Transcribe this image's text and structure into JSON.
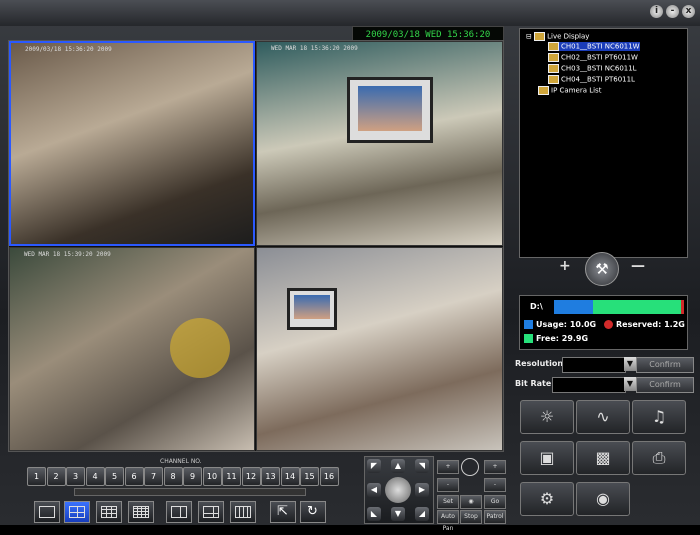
{
  "status": {
    "date": "2009/03/18",
    "weekday": "WED",
    "time": "15:36:20"
  },
  "window_controls": [
    "i",
    "-",
    "x"
  ],
  "cameras": [
    {
      "timestamp": "2009/03/18 15:36:20 2009"
    },
    {
      "timestamp": "WED MAR 18 15:36:20 2009"
    },
    {
      "timestamp": "WED MAR 18 15:39:20 2009"
    },
    {
      "timestamp": ""
    }
  ],
  "tree": {
    "root": "Live Display",
    "channels": [
      "CH01__BSTI NC6011W",
      "CH02__BSTI PT6011W",
      "CH03__BSTI NC6011L",
      "CH04__BSTI PT6011L"
    ],
    "ip_list": "IP Camera List"
  },
  "tool_row": {
    "plus": "+",
    "minus": "—",
    "tool_icon": "⚒"
  },
  "disk": {
    "drive": "D:\\",
    "usage_label": "Usage:",
    "usage_value": "10.0G",
    "reserved_label": "Reserved:",
    "reserved_value": "1.2G",
    "free_label": "Free:",
    "free_value": "29.9G",
    "free_fraction": 0.7,
    "colors": {
      "usage": "#1f7de0",
      "free": "#27e07a",
      "reserved": "#d12a2a"
    }
  },
  "settings": {
    "resolution_label": "Resolution",
    "bitrate_label": "Bit Rate",
    "confirm_label": "Confirm",
    "arrow": "▼"
  },
  "bottom": {
    "channel_label": "CHANNEL NO.",
    "channels": [
      "1",
      "2",
      "3",
      "4",
      "5",
      "6",
      "7",
      "8",
      "9",
      "10",
      "11",
      "12",
      "13",
      "14",
      "15",
      "16"
    ]
  },
  "ptz": {
    "arrows": [
      "◤",
      "▲",
      "◥",
      "◀",
      "▶",
      "◣",
      "▼",
      "◢"
    ],
    "set": "Set",
    "go": "Go",
    "auto_pan": "Auto Pan",
    "stop": "Stop",
    "patrol": "Patrol",
    "zoom_in": "+",
    "zoom_out": "-"
  },
  "icons": {
    "mic": "☼",
    "waveform": "∿",
    "speaker": "♫",
    "record": "▣",
    "snapshot": "▩",
    "print": "⎙",
    "gear": "⚙",
    "playback": "◉",
    "fullscreen": "⇱",
    "cycle": "↻"
  }
}
